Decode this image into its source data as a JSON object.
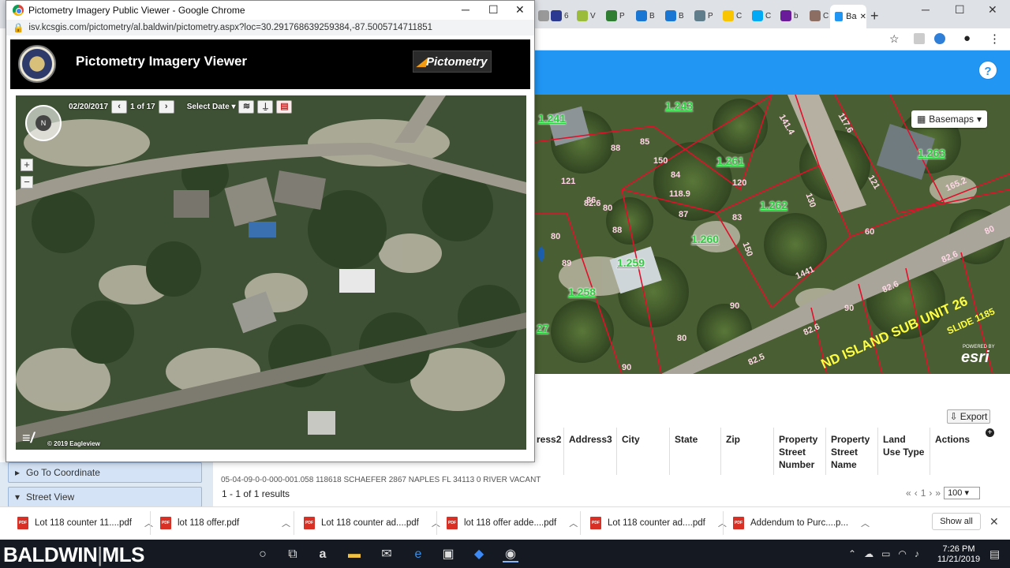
{
  "browser": {
    "tabs": [
      "",
      "6",
      "V",
      "P",
      "B",
      "B",
      "P",
      "C",
      "C",
      "b",
      "C"
    ],
    "active_tab": "Ba",
    "new_tab": "+"
  },
  "app": {
    "help": "?",
    "basemaps_label": "Basemaps",
    "esri_label": "esri",
    "esri_powered": "POWERED BY",
    "parcels": [
      "1.241",
      "1.243",
      "1.261",
      "1.263",
      "1.262",
      "1.260",
      "1.259",
      "1.258",
      "121",
      "27"
    ],
    "dims": [
      "141.4",
      "88",
      "85",
      "150",
      "120",
      "86",
      "84",
      "118.9",
      "83",
      "130",
      "80",
      "88",
      "87",
      "150",
      "90",
      "80",
      "82.6",
      "89",
      "1441",
      "60",
      "82.6",
      "90",
      "82.6",
      "80",
      "82.5",
      "82.6",
      "90",
      "117.6",
      "121",
      "165.2",
      "80"
    ],
    "subdivision_label": "ND ISLAND SUB UNIT 26",
    "slide_label": "SLIDE 1185"
  },
  "grid": {
    "export_label": "Export",
    "columns": [
      "ress2",
      "Address3",
      "City",
      "State",
      "Zip",
      "Property Street Number",
      "Property Street Name",
      "Land Use Type",
      "Actions"
    ],
    "row_text": "05-04-09-0-0-000-001.058   118618  SCHAEFER  2867        NAPLES   FL   34113   0   RIVER   VACANT",
    "results": "1 - 1 of 1 results",
    "pager": [
      "«",
      "‹",
      "1",
      "›",
      "»"
    ],
    "page_size": "100",
    "add": "+"
  },
  "left_panel": {
    "items": [
      "Go To Coordinate",
      "Street View"
    ]
  },
  "downloads": {
    "items": [
      "Lot 118 counter 11....pdf",
      "lot 118 offer.pdf",
      "Lot 118 counter ad....pdf",
      "lot 118 offer adde....pdf",
      "Lot 118 counter ad....pdf",
      "Addendum to Purc....p..."
    ],
    "show_all": "Show all",
    "close": "✕",
    "icon_text": "PDF"
  },
  "taskbar": {
    "brand_bold": "BALDWIN",
    "brand_sep": "|",
    "brand_rest": "MLS",
    "time": "7:26 PM",
    "date": "11/21/2019"
  },
  "popup": {
    "title": "Pictometry Imagery Public Viewer - Google Chrome",
    "url": "isv.kcsgis.com/pictometry/al.baldwin/pictometry.aspx?loc=30.291768639259384,-87.5005714711851",
    "viewer_title": "Pictometry Imagery Viewer",
    "logo_text": "Pictometry",
    "date": "02/20/2017",
    "count": "1 of 17",
    "select_date": "Select Date ▾",
    "copyright": "© 2019 Eagleview",
    "compass_n": "N"
  },
  "colors": {
    "accent": "#2196f3",
    "parcel_line": "#e0102a",
    "parcel_label": "#2ecc40"
  }
}
